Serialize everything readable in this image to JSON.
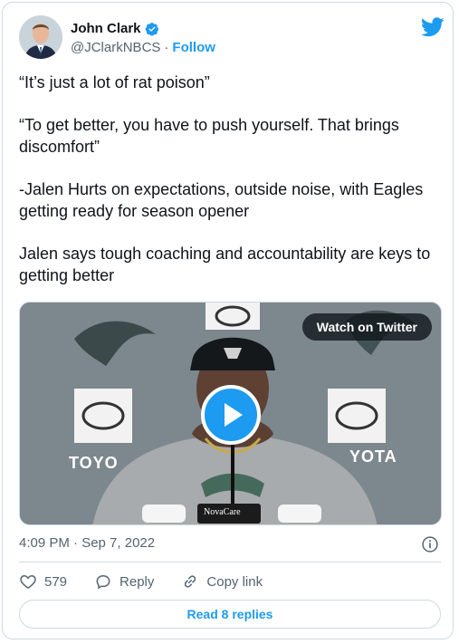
{
  "author": {
    "display_name": "John Clark",
    "handle": "@JClarkNBCS",
    "separator": "·",
    "follow_label": "Follow",
    "verified": true
  },
  "tweet": {
    "paragraphs": [
      "“It’s just a lot of rat poison”",
      "“To get better, you have to push yourself. That brings discomfort”",
      "-Jalen Hurts on expectations, outside noise, with Eagles getting ready for season opener",
      "Jalen says tough coaching and accountability are keys to getting better"
    ]
  },
  "media": {
    "watch_label": "Watch on Twitter",
    "backdrop_text_left": "TOYO",
    "backdrop_text_right": "YOTA",
    "mic_sign": "NovaCare"
  },
  "meta": {
    "timestamp": "4:09 PM · Sep 7, 2022"
  },
  "actions": {
    "like_count": "579",
    "reply_label": "Reply",
    "copy_link_label": "Copy link"
  },
  "read_replies_label": "Read 8 replies",
  "colors": {
    "accent": "#1d9bf0",
    "text": "#0f1419",
    "muted": "#536471",
    "border": "#cfd9de"
  }
}
